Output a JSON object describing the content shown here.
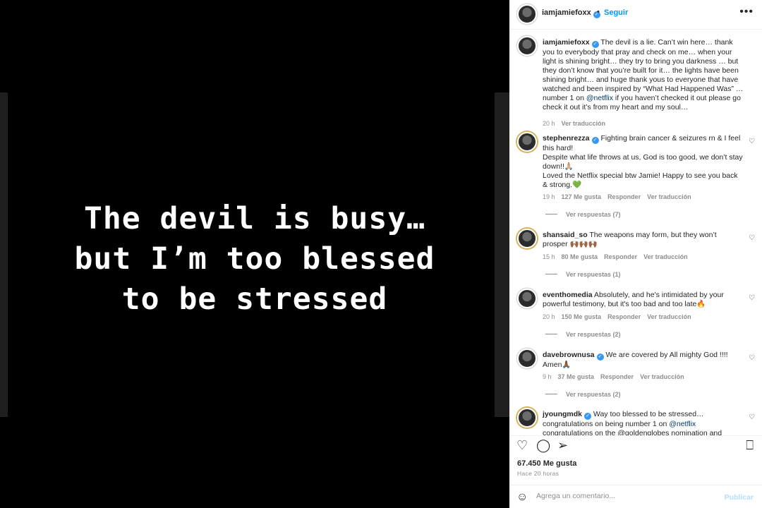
{
  "story": {
    "lines": [
      "The devil is busy…",
      "but I’m too blessed",
      "to be stressed"
    ]
  },
  "header": {
    "username": "iamjamiefoxx",
    "follow_label": "Seguir",
    "more_icon": "more-icon"
  },
  "caption": {
    "username": "iamjamiefoxx",
    "text_before_link": " The devil is a lie. Can’t win here… thank you to everybody that pray and check on me… when your light is shining bright… they try to bring you darkness … but they don’t know that you’re built for it… the lights have been shining bright… and huge thank yous to everyone that have watched and been inspired by “What Had Happened Was” … number 1 on ",
    "link": "@netflix",
    "text_after_link": " if you haven’t checked it out please go check it out it’s from my heart and my soul…",
    "time": "20 h",
    "translate": "Ver traducción"
  },
  "comments": [
    {
      "username": "stephenrezza",
      "verified": true,
      "text": " Fighting brain cancer & seizures rn & I feel this hard!\nDespite what life throws at us, God is too good, we don’t stay down!!🙏🏼\nLoved the Netflix special btw Jamie! Happy to see you back & strong.💚",
      "time": "19 h",
      "likes": "127 Me gusta",
      "reply": "Responder",
      "translate": "Ver traducción",
      "replies": "Ver respuestas (7)"
    },
    {
      "username": "shansaid_so",
      "verified": false,
      "text": " The weapons may form, but they won’t prosper 🙌🏾🙌🏾🙌🏾",
      "time": "15 h",
      "likes": "80 Me gusta",
      "reply": "Responder",
      "translate": "Ver traducción",
      "replies": "Ver respuestas (1)"
    },
    {
      "username": "eventhomedia",
      "verified": false,
      "text": " Absolutely, and he's intimidated by your powerful testimony, but it's too bad and too late🔥",
      "time": "20 h",
      "likes": "150 Me gusta",
      "reply": "Responder",
      "translate": "Ver traducción",
      "replies": "Ver respuestas (2)"
    },
    {
      "username": "davebrownusa",
      "verified": true,
      "text": " We are covered by All mighty God !!!!\nAmen🙏🏾",
      "time": "9 h",
      "likes": "37 Me gusta",
      "reply": "Responder",
      "translate": "Ver traducción",
      "replies": "Ver respuestas (2)"
    },
    {
      "username": "jyoungmdk",
      "verified": true,
      "text_before_link": " Way too blessed to be stressed…\ncongratulations on being number 1 on ",
      "link": "@netflix",
      "text_partial": "congratulations on the @goldenglobes nomination and"
    }
  ],
  "footer": {
    "likes": "67.450 Me gusta",
    "time_ago": "Hace 20 horas",
    "comment_placeholder": "Agrega un comentario...",
    "publish_label": "Publicar"
  },
  "colors": {
    "accent": "#0095f6",
    "verified": "#3897f0",
    "publish_disabled": "#b2dffc"
  }
}
